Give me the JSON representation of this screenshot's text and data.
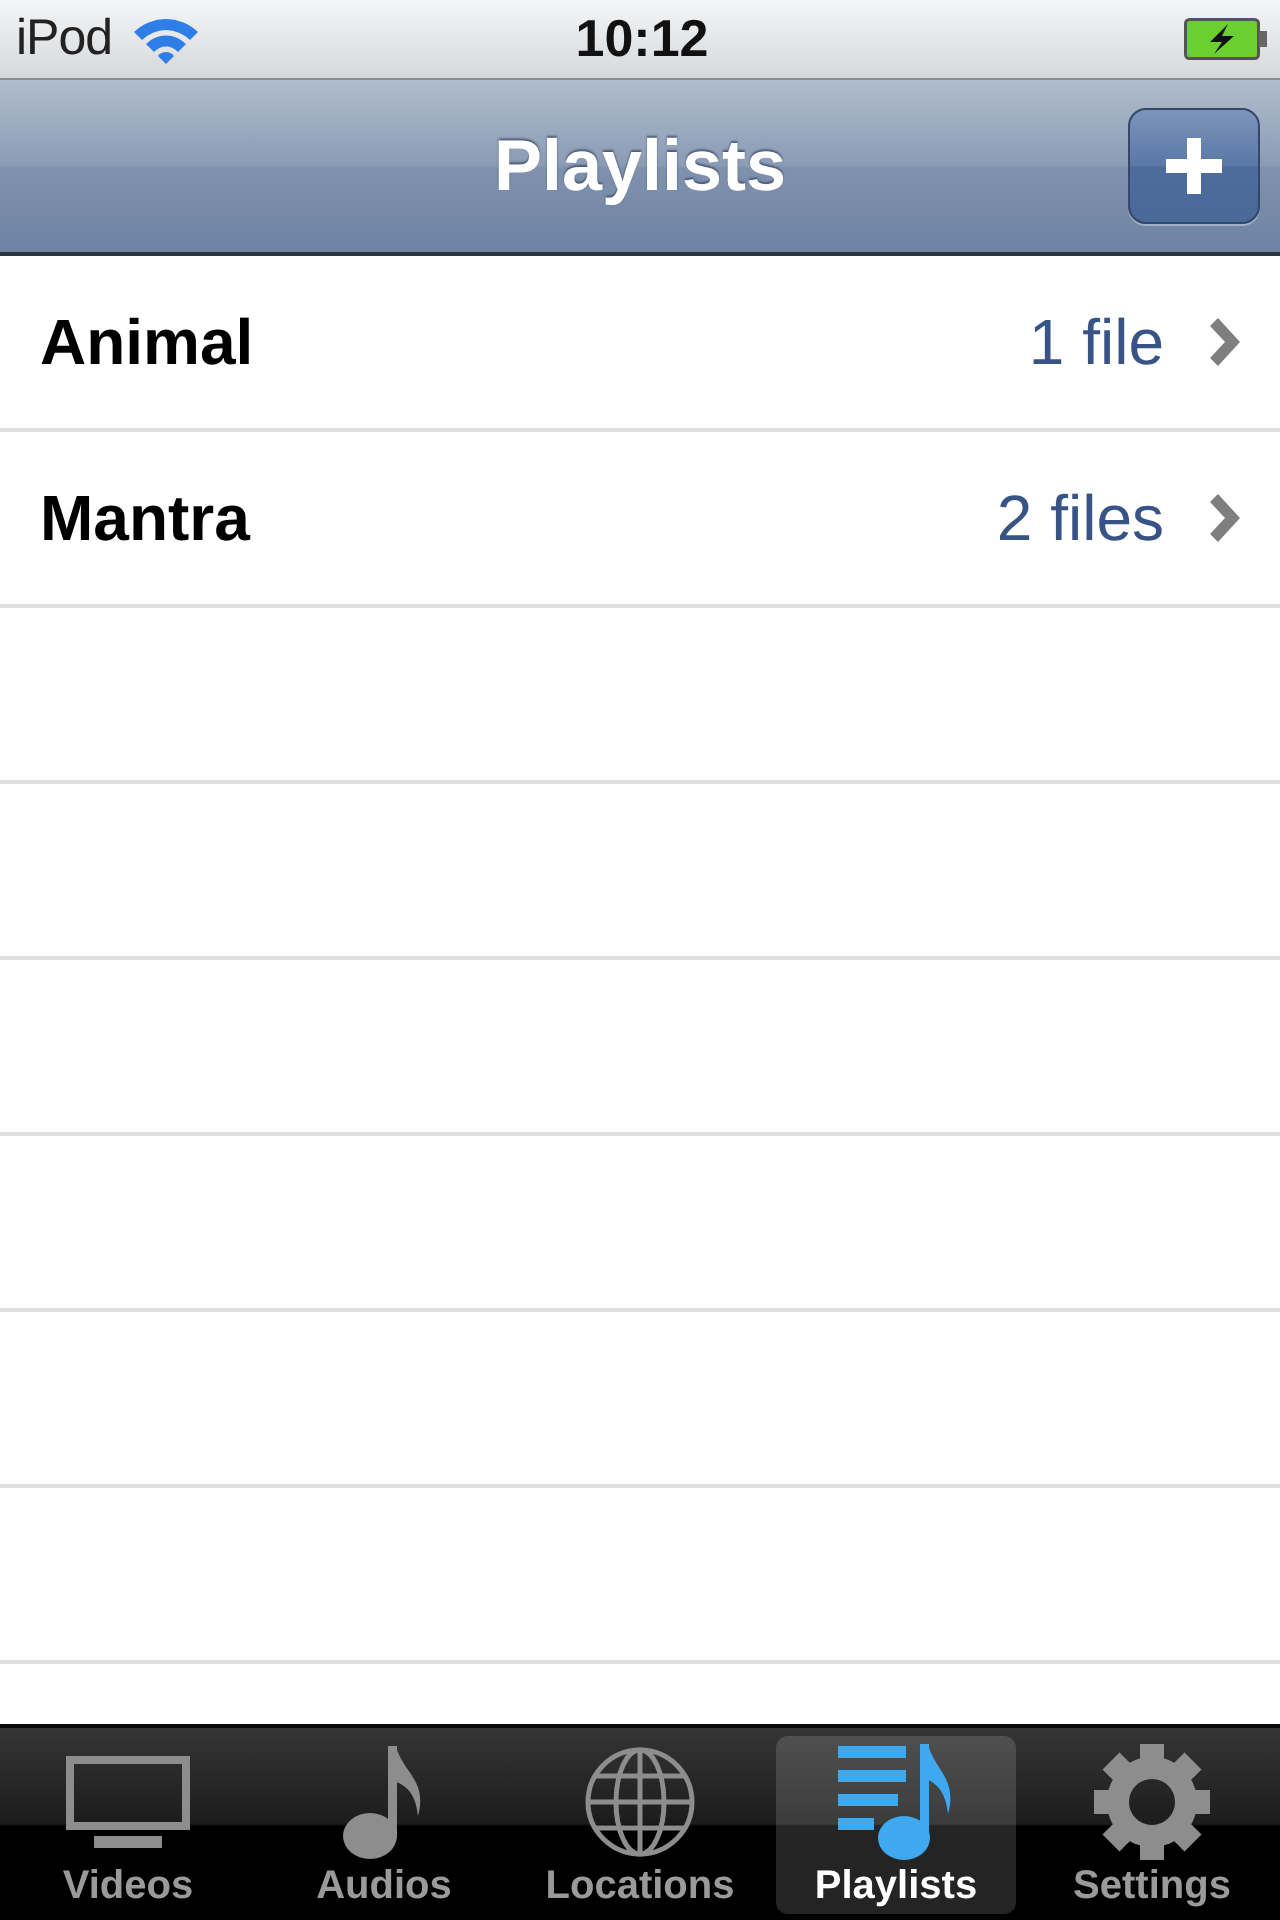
{
  "status_bar": {
    "carrier": "iPod",
    "time": "10:12"
  },
  "nav_bar": {
    "title": "Playlists"
  },
  "playlists": [
    {
      "name": "Animal",
      "count": "1 file"
    },
    {
      "name": "Mantra",
      "count": "2 files"
    }
  ],
  "tab_bar": [
    {
      "label": "Videos",
      "kind": "tv",
      "selected": false
    },
    {
      "label": "Audios",
      "kind": "note",
      "selected": false
    },
    {
      "label": "Locations",
      "kind": "globe",
      "selected": false
    },
    {
      "label": "Playlists",
      "kind": "playlist",
      "selected": true
    },
    {
      "label": "Settings",
      "kind": "gear",
      "selected": false
    }
  ]
}
